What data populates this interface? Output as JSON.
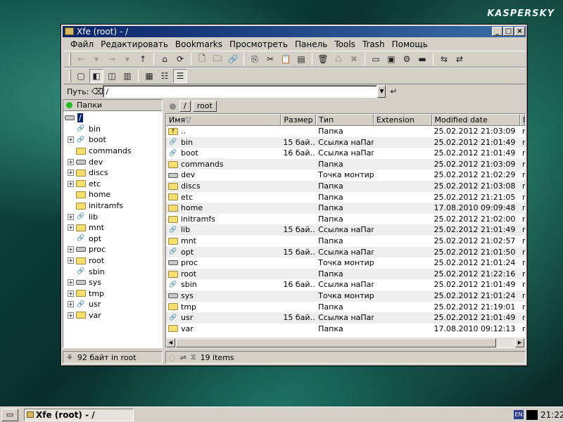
{
  "desktop": {
    "brand": "KASPERSKY"
  },
  "window": {
    "title": "Xfe (root) - /",
    "buttons": {
      "minimize": "_",
      "maximize": "□",
      "close": "×"
    }
  },
  "menu": [
    "Файл",
    "Редактировать",
    "Bookmarks",
    "Просмотреть",
    "Панель",
    "Tools",
    "Trash",
    "Помощь"
  ],
  "location": {
    "label": "Путь:",
    "value": "/"
  },
  "left_panel": {
    "header": "Папки",
    "root": "/",
    "tree": [
      {
        "name": "bin",
        "icon": "link-icon",
        "expand": ""
      },
      {
        "name": "boot",
        "icon": "link-icon",
        "expand": "+"
      },
      {
        "name": "commands",
        "icon": "folder-icon",
        "expand": ""
      },
      {
        "name": "dev",
        "icon": "drive-icon",
        "expand": "+"
      },
      {
        "name": "discs",
        "icon": "folder-icon",
        "expand": "+"
      },
      {
        "name": "etc",
        "icon": "folder-icon",
        "expand": "+"
      },
      {
        "name": "home",
        "icon": "folder-icon",
        "expand": ""
      },
      {
        "name": "initramfs",
        "icon": "folder-icon",
        "expand": ""
      },
      {
        "name": "lib",
        "icon": "link-icon",
        "expand": "+"
      },
      {
        "name": "mnt",
        "icon": "folder-icon",
        "expand": "+"
      },
      {
        "name": "opt",
        "icon": "link-icon",
        "expand": ""
      },
      {
        "name": "proc",
        "icon": "drive-icon",
        "expand": "+"
      },
      {
        "name": "root",
        "icon": "folder-icon",
        "expand": "+"
      },
      {
        "name": "sbin",
        "icon": "link-icon",
        "expand": ""
      },
      {
        "name": "sys",
        "icon": "drive-icon",
        "expand": "+"
      },
      {
        "name": "tmp",
        "icon": "folder-icon",
        "expand": "+"
      },
      {
        "name": "usr",
        "icon": "link-icon",
        "expand": "+"
      },
      {
        "name": "var",
        "icon": "folder-icon",
        "expand": "+"
      }
    ],
    "status": "92 байт in root"
  },
  "right_panel": {
    "breadcrumbs": [
      "/",
      "root"
    ],
    "columns": [
      "Имя",
      "Размер",
      "Тип",
      "Extension",
      "Modified date",
      "П"
    ],
    "rows": [
      {
        "name": "..",
        "icon": "folder-up-icon",
        "size": "",
        "type": "Папка",
        "ext": "",
        "date": "25.02.2012 21:03:09",
        "extra": "r"
      },
      {
        "name": "bin",
        "icon": "link-icon",
        "size": "15 бай…",
        "type": "Ссылка наПап…",
        "ext": "",
        "date": "25.02.2012 21:01:49",
        "extra": "r"
      },
      {
        "name": "boot",
        "icon": "link-icon",
        "size": "16 бай…",
        "type": "Ссылка наПап…",
        "ext": "",
        "date": "25.02.2012 21:01:49",
        "extra": "r"
      },
      {
        "name": "commands",
        "icon": "folder-icon",
        "size": "",
        "type": "Папка",
        "ext": "",
        "date": "25.02.2012 21:03:09",
        "extra": "r"
      },
      {
        "name": "dev",
        "icon": "drive-icon",
        "size": "",
        "type": "Точка монтир…",
        "ext": "",
        "date": "25.02.2012 21:02:29",
        "extra": "r"
      },
      {
        "name": "discs",
        "icon": "folder-icon",
        "size": "",
        "type": "Папка",
        "ext": "",
        "date": "25.02.2012 21:03:08",
        "extra": "r"
      },
      {
        "name": "etc",
        "icon": "folder-icon",
        "size": "",
        "type": "Папка",
        "ext": "",
        "date": "25.02.2012 21:21:05",
        "extra": "r"
      },
      {
        "name": "home",
        "icon": "folder-icon",
        "size": "",
        "type": "Папка",
        "ext": "",
        "date": "17.08.2010 09:09:48",
        "extra": "r"
      },
      {
        "name": "initramfs",
        "icon": "folder-icon",
        "size": "",
        "type": "Папка",
        "ext": "",
        "date": "25.02.2012 21:02:00",
        "extra": "r"
      },
      {
        "name": "lib",
        "icon": "link-icon",
        "size": "15 бай…",
        "type": "Ссылка наПап…",
        "ext": "",
        "date": "25.02.2012 21:01:49",
        "extra": "r"
      },
      {
        "name": "mnt",
        "icon": "folder-icon",
        "size": "",
        "type": "Папка",
        "ext": "",
        "date": "25.02.2012 21:02:57",
        "extra": "r"
      },
      {
        "name": "opt",
        "icon": "link-icon",
        "size": "15 бай…",
        "type": "Ссылка наПап…",
        "ext": "",
        "date": "25.02.2012 21:01:50",
        "extra": "r"
      },
      {
        "name": "proc",
        "icon": "drive-icon",
        "size": "",
        "type": "Точка монтир…",
        "ext": "",
        "date": "25.02.2012 21:01:24",
        "extra": "r"
      },
      {
        "name": "root",
        "icon": "folder-icon",
        "size": "",
        "type": "Папка",
        "ext": "",
        "date": "25.02.2012 21:22:16",
        "extra": "r"
      },
      {
        "name": "sbin",
        "icon": "link-icon",
        "size": "16 бай…",
        "type": "Ссылка наПап…",
        "ext": "",
        "date": "25.02.2012 21:01:49",
        "extra": "r"
      },
      {
        "name": "sys",
        "icon": "drive-icon",
        "size": "",
        "type": "Точка монтир…",
        "ext": "",
        "date": "25.02.2012 21:01:24",
        "extra": "r"
      },
      {
        "name": "tmp",
        "icon": "folder-icon",
        "size": "",
        "type": "Папка",
        "ext": "",
        "date": "25.02.2012 21:19:01",
        "extra": "r"
      },
      {
        "name": "usr",
        "icon": "link-icon",
        "size": "15 бай…",
        "type": "Ссылка наПап…",
        "ext": "",
        "date": "25.02.2012 21:01:49",
        "extra": "r"
      },
      {
        "name": "var",
        "icon": "folder-icon",
        "size": "",
        "type": "Папка",
        "ext": "",
        "date": "17.08.2010 09:12:13",
        "extra": "r"
      }
    ],
    "status": "19 items"
  },
  "taskbar": {
    "task": "Xfe (root) - /",
    "lang": "EN",
    "clock": "21:22"
  },
  "colors": {
    "title_active": "#0a246a",
    "chrome": "#d4d0c8",
    "folder": "#f3de6e"
  }
}
